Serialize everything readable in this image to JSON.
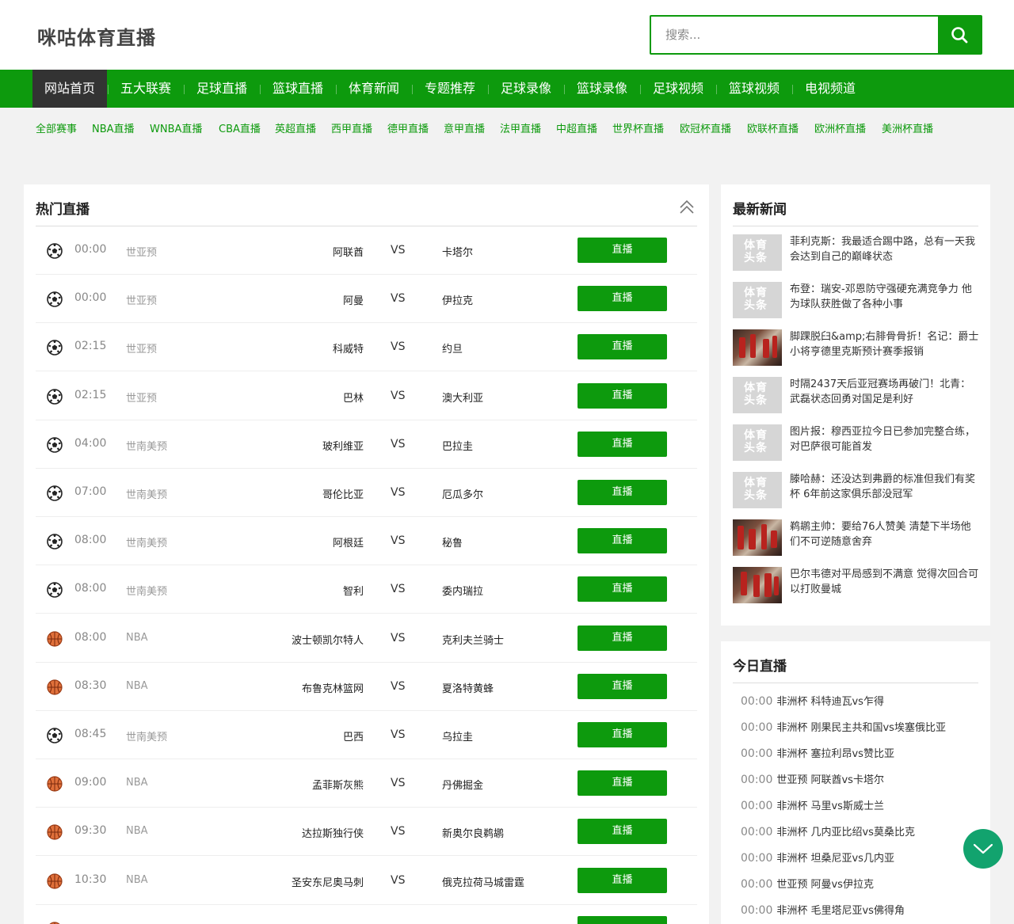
{
  "site": {
    "logo": "咪咕体育直播"
  },
  "search": {
    "placeholder": "搜索..."
  },
  "nav": [
    "网站首页",
    "五大联赛",
    "足球直播",
    "篮球直播",
    "体育新闻",
    "专题推荐",
    "足球录像",
    "篮球录像",
    "足球视频",
    "篮球视频",
    "电视频道"
  ],
  "subnav": [
    "全部赛事",
    "NBA直播",
    "WNBA直播",
    "CBA直播",
    "英超直播",
    "西甲直播",
    "德甲直播",
    "意甲直播",
    "法甲直播",
    "中超直播",
    "世界杯直播",
    "欧冠杯直播",
    "欧联杯直播",
    "欧洲杯直播",
    "美洲杯直播"
  ],
  "hot": {
    "title": "热门直播",
    "vs_label": "VS",
    "button_label": "直播",
    "matches": [
      {
        "sport": "football",
        "time": "00:00",
        "league": "世亚预",
        "home": "阿联酋",
        "away": "卡塔尔"
      },
      {
        "sport": "football",
        "time": "00:00",
        "league": "世亚预",
        "home": "阿曼",
        "away": "伊拉克"
      },
      {
        "sport": "football",
        "time": "02:15",
        "league": "世亚预",
        "home": "科威特",
        "away": "约旦"
      },
      {
        "sport": "football",
        "time": "02:15",
        "league": "世亚预",
        "home": "巴林",
        "away": "澳大利亚"
      },
      {
        "sport": "football",
        "time": "04:00",
        "league": "世南美预",
        "home": "玻利维亚",
        "away": "巴拉圭"
      },
      {
        "sport": "football",
        "time": "07:00",
        "league": "世南美预",
        "home": "哥伦比亚",
        "away": "厄瓜多尔"
      },
      {
        "sport": "football",
        "time": "08:00",
        "league": "世南美预",
        "home": "阿根廷",
        "away": "秘鲁"
      },
      {
        "sport": "football",
        "time": "08:00",
        "league": "世南美预",
        "home": "智利",
        "away": "委内瑞拉"
      },
      {
        "sport": "basketball",
        "time": "08:00",
        "league": "NBA",
        "home": "波士顿凯尔特人",
        "away": "克利夫兰骑士"
      },
      {
        "sport": "basketball",
        "time": "08:30",
        "league": "NBA",
        "home": "布鲁克林篮网",
        "away": "夏洛特黄蜂"
      },
      {
        "sport": "football",
        "time": "08:45",
        "league": "世南美预",
        "home": "巴西",
        "away": "乌拉圭"
      },
      {
        "sport": "basketball",
        "time": "09:00",
        "league": "NBA",
        "home": "孟菲斯灰熊",
        "away": "丹佛掘金"
      },
      {
        "sport": "basketball",
        "time": "09:30",
        "league": "NBA",
        "home": "达拉斯独行侠",
        "away": "新奥尔良鹈鹕"
      },
      {
        "sport": "basketball",
        "time": "10:30",
        "league": "NBA",
        "home": "圣安东尼奥马刺",
        "away": "俄克拉荷马城雷霆"
      },
      {
        "sport": "basketball",
        "time": "",
        "league": "",
        "home": "",
        "away": ""
      }
    ]
  },
  "news": {
    "title": "最新新闻",
    "placeholder_label_1": "体育",
    "placeholder_label_2": "头条",
    "items": [
      {
        "thumb": "placeholder",
        "text": "菲利克斯：我最适合踢中路，总有一天我会达到自己的巅峰状态"
      },
      {
        "thumb": "placeholder",
        "text": "布登：瑞安-邓恩防守强硬充满竞争力 他为球队获胜做了各种小事"
      },
      {
        "thumb": "photo",
        "text": "脚踝脱臼&amp;右腓骨骨折！名记：爵士小将亨德里克斯预计赛季报销"
      },
      {
        "thumb": "placeholder",
        "text": "时隔2437天后亚冠赛场再破门！北青：武磊状态回勇对国足是利好"
      },
      {
        "thumb": "placeholder",
        "text": "图片报：穆西亚拉今日已参加完整合练，对巴萨很可能首发"
      },
      {
        "thumb": "placeholder",
        "text": "滕哈赫：还没达到弗爵的标准但我们有奖杯 6年前这家俱乐部没冠军"
      },
      {
        "thumb": "photo",
        "text": "鹈鹕主帅：要给76人赞美 清楚下半场他们不可逆随意舍弃"
      },
      {
        "thumb": "photo",
        "text": "巴尔韦德对平局感到不满意 觉得次回合可以打败曼城"
      }
    ]
  },
  "today": {
    "title": "今日直播",
    "items": [
      {
        "time": "00:00",
        "text": "非洲杯 科特迪瓦vs乍得"
      },
      {
        "time": "00:00",
        "text": "非洲杯 刚果民主共和国vs埃塞俄比亚"
      },
      {
        "time": "00:00",
        "text": "非洲杯 塞拉利昂vs赞比亚"
      },
      {
        "time": "00:00",
        "text": "世亚预 阿联酋vs卡塔尔"
      },
      {
        "time": "00:00",
        "text": "非洲杯 马里vs斯威士兰"
      },
      {
        "time": "00:00",
        "text": "非洲杯 几内亚比绍vs莫桑比克"
      },
      {
        "time": "00:00",
        "text": "非洲杯 坦桑尼亚vs几内亚"
      },
      {
        "time": "00:00",
        "text": "世亚预 阿曼vs伊拉克"
      },
      {
        "time": "00:00",
        "text": "非洲杯 毛里塔尼亚vs佛得角"
      }
    ]
  },
  "colors": {
    "brand": "#0d9a0d",
    "nav_active": "#333333",
    "scroll_button": "#12a36e"
  },
  "icons": {
    "search": "search-icon",
    "collapse": "double-chevron-up-icon",
    "scroll": "chevron-down-icon",
    "football": "football-icon",
    "basketball": "basketball-icon"
  }
}
